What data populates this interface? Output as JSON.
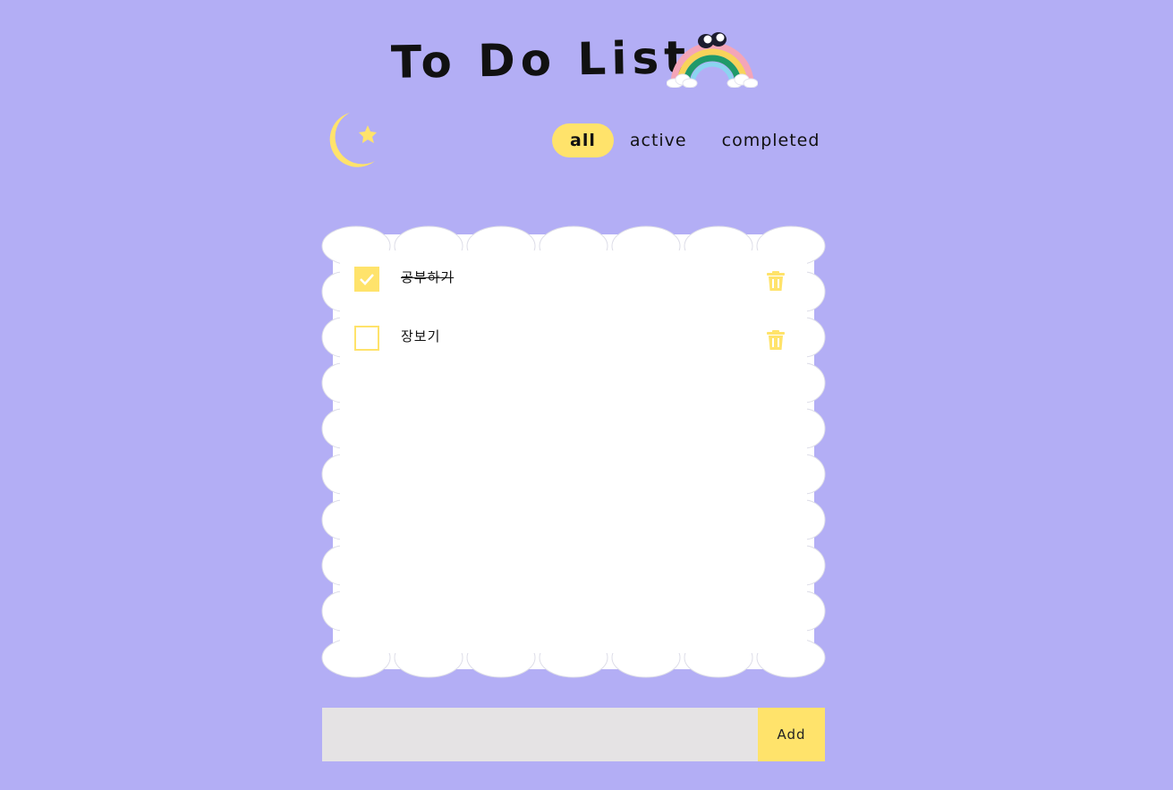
{
  "header": {
    "title": "To Do List",
    "rainbow_icon": "rainbow-with-eyes-icon",
    "theme_icon": "moon-star-icon"
  },
  "filters": {
    "all": "all",
    "active": "active",
    "completed": "completed",
    "selected": "all"
  },
  "todos": [
    {
      "text": "공부하기",
      "completed": true
    },
    {
      "text": "장보기",
      "completed": false
    }
  ],
  "form": {
    "input_value": "",
    "add_label": "Add"
  },
  "colors": {
    "background": "#b3aef5",
    "accent": "#ffe36b",
    "card": "#ffffff",
    "input": "#e5e3e4"
  }
}
